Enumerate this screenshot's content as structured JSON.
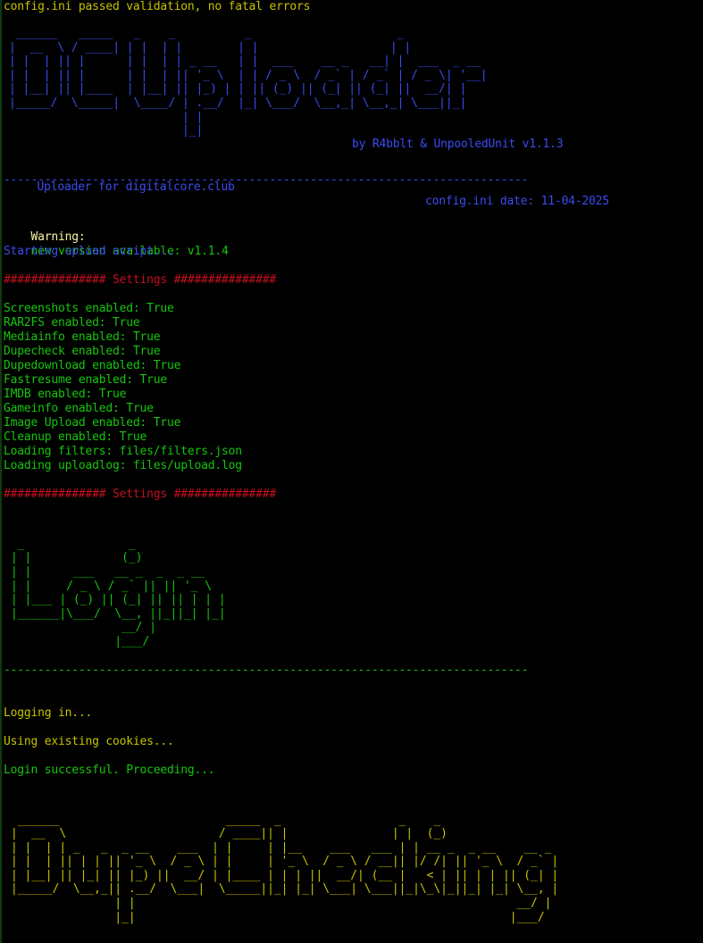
{
  "colors": {
    "background": "#000000",
    "green": "#16c60c",
    "blue": "#3b4cf0",
    "red": "#c50f1f",
    "yellow": "#c7c300",
    "warning_label": "#f9f1a5"
  },
  "validation": "config.ini passed validation, no fatal errors",
  "banner": {
    "art": " ______   _____   _    _          _                     _\n|  __  \\ / ____| | |  | |        | |                   | |\n| |  | || |      | |  | | _ __   | |  ___    __ _   __| |  ___  _ __\n| |  | || |      | |  | || '_ \\  | | / _ \\  / _` | / _` | / _ \\| '__|\n| |__| || |____  | |__| || |_) | | || (_) || (_| || (_| ||  __/| |\n|_____/  \\_____|  \\____/ | .__/  |_| \\___/  \\__,_| \\__,_| \\___||_|\n                         | |\n                         |_|",
    "credits": "by R4bblt & UnpooledUnit v1.1.3",
    "subtitle": "Uploader for digitalcore.club",
    "config_date": "config.ini date: 11-04-2025",
    "divider": "-----------------------------------------------------------------------------"
  },
  "warning": {
    "label": "Warning:",
    "message": "new version available: v1.1.4"
  },
  "starting": "Starting upload script...",
  "settings_header": "############### Settings ###############",
  "settings": [
    "Screenshots enabled: True",
    "RAR2FS enabled: True",
    "Mediainfo enabled: True",
    "Dupecheck enabled: True",
    "Dupedownload enabled: True",
    "Fastresume enabled: True",
    "IMDB enabled: True",
    "Gameinfo enabled: True",
    "Image Upload enabled: True",
    "Cleanup enabled: True",
    "Loading filters: files/filters.json",
    "Loading uploadlog: files/upload.log"
  ],
  "settings_footer": "############### Settings ###############",
  "login": {
    "art": " _               _\n| |             (_)\n| |      ___   __ _  _  _ __\n| |     / _ \\ / _` || || '_ \\\n| |___ | (_) || (_| || || | | |\n|______|\\___/  \\__, ||_||_| |_|\n                __/ |\n               |___/",
    "divider": "-----------------------------------------------------------------------------",
    "logging_in": "Logging in...",
    "cookies": "Using existing cookies...",
    "success": "Login successful. Proceeding..."
  },
  "dupecheck": {
    "art": " ______                        _____  _                 _    _\n|  __  \\                      / ____|| |               | |  (_)\n| |  | | _   _  _ __    ___  | |     | |__    ___   ___ | | __ _  _ __    __ _\n| |  | || | | || '_ \\  / _ \\ | |     | '_ \\  / _ \\ / __|| |/ /| || '_ \\  / _` |\n| |__| || |_| || |_) ||  __/ | |____ | | | ||  __/| (__ |   < | || | | || (_| |\n|_____/  \\__,_|| .__/  \\___|  \\_____||_| |_| \\___| \\___||_|\\_\\|_||_| |_| \\__, |\n               | |                                                       __/ |\n               |_|                                                      |___/"
  }
}
